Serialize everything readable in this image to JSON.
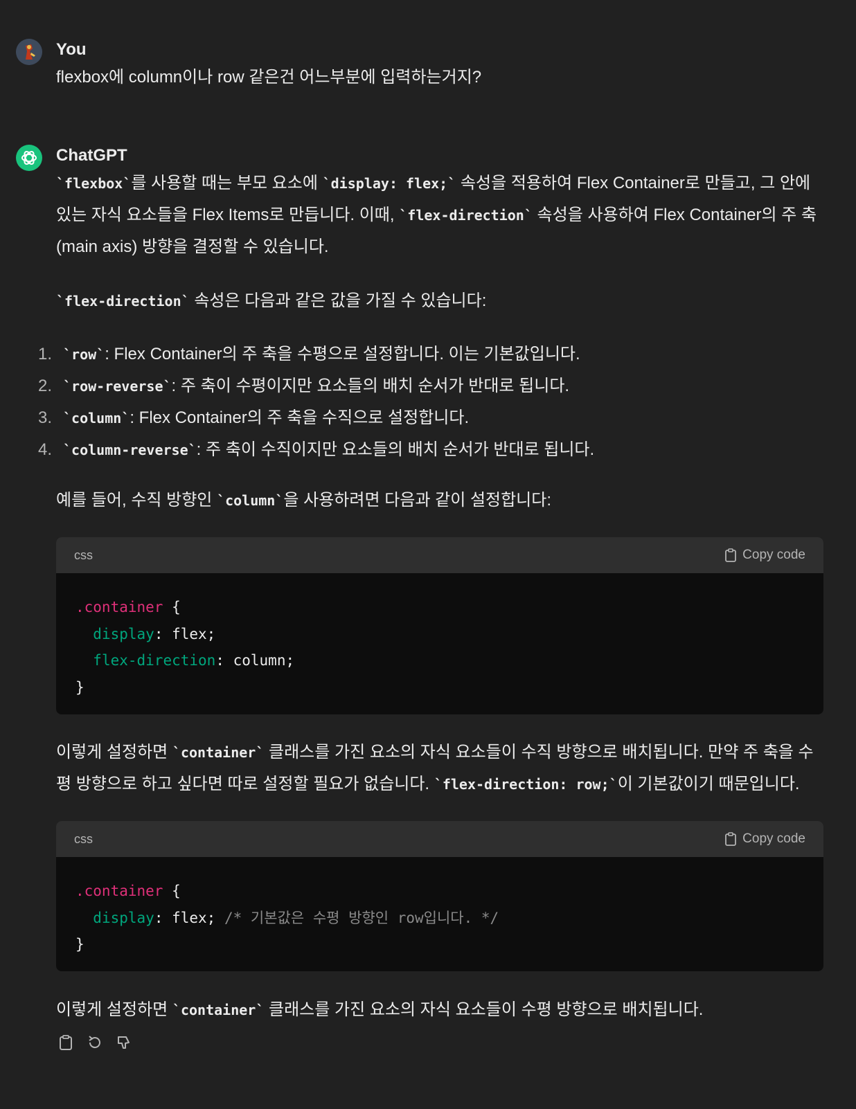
{
  "user": {
    "name": "You",
    "message": "flexbox에 column이나 row 같은건 어느부분에 입력하는거지?"
  },
  "assistant": {
    "name": "ChatGPT",
    "p1": {
      "c1": "`flexbox`",
      "t1": "를 사용할 때는 부모 요소에 ",
      "c2": "`display: flex;`",
      "t2": " 속성을 적용하여 Flex Container로 만들고, 그 안에 있는 자식 요소들을 Flex Items로 만듭니다. 이때, ",
      "c3": "`flex-direction`",
      "t3": " 속성을 사용하여 Flex Container의 주 축(main axis) 방향을 결정할 수 있습니다."
    },
    "p2": {
      "c1": "`flex-direction`",
      "t1": " 속성은 다음과 같은 값을 가질 수 있습니다:"
    },
    "list": [
      {
        "num": "1.",
        "code": "`row`",
        "text": ": Flex Container의 주 축을 수평으로 설정합니다. 이는 기본값입니다."
      },
      {
        "num": "2.",
        "code": "`row-reverse`",
        "text": ": 주 축이 수평이지만 요소들의 배치 순서가 반대로 됩니다."
      },
      {
        "num": "3.",
        "code": "`column`",
        "text": ": Flex Container의 주 축을 수직으로 설정합니다."
      },
      {
        "num": "4.",
        "code": "`column-reverse`",
        "text": ": 주 축이 수직이지만 요소들의 배치 순서가 반대로 됩니다."
      }
    ],
    "p3": {
      "t1": "예를 들어, 수직 방향인 ",
      "c1": "`column`",
      "t2": "을 사용하려면 다음과 같이 설정합니다:"
    },
    "code1": {
      "lang": "css",
      "copy": "Copy code",
      "l1_sel": ".container",
      "l1_rest": " {",
      "l2_prop": "display",
      "l2_rest": ": flex;",
      "l3_prop": "flex-direction",
      "l3_rest": ": column;",
      "l4": "}"
    },
    "p4": {
      "t1": "이렇게 설정하면 ",
      "c1": "`container`",
      "t2": " 클래스를 가진 요소의 자식 요소들이 수직 방향으로 배치됩니다. 만약 주 축을 수평 방향으로 하고 싶다면 따로 설정할 필요가 없습니다. ",
      "c2": "`flex-direction: row;`",
      "t3": "이 기본값이기 때문입니다."
    },
    "code2": {
      "lang": "css",
      "copy": "Copy code",
      "l1_sel": ".container",
      "l1_rest": " {",
      "l2_prop": "display",
      "l2_rest": ": flex; ",
      "l2_cmt": "/* 기본값은 수평 방향인 row입니다. */",
      "l3": "}"
    },
    "p5": {
      "t1": "이렇게 설정하면 ",
      "c1": "`container`",
      "t2": " 클래스를 가진 요소의 자식 요소들이 수평 방향으로 배치됩니다."
    }
  },
  "actions": [
    "clipboard-icon",
    "regenerate-icon",
    "thumbs-down-icon"
  ]
}
